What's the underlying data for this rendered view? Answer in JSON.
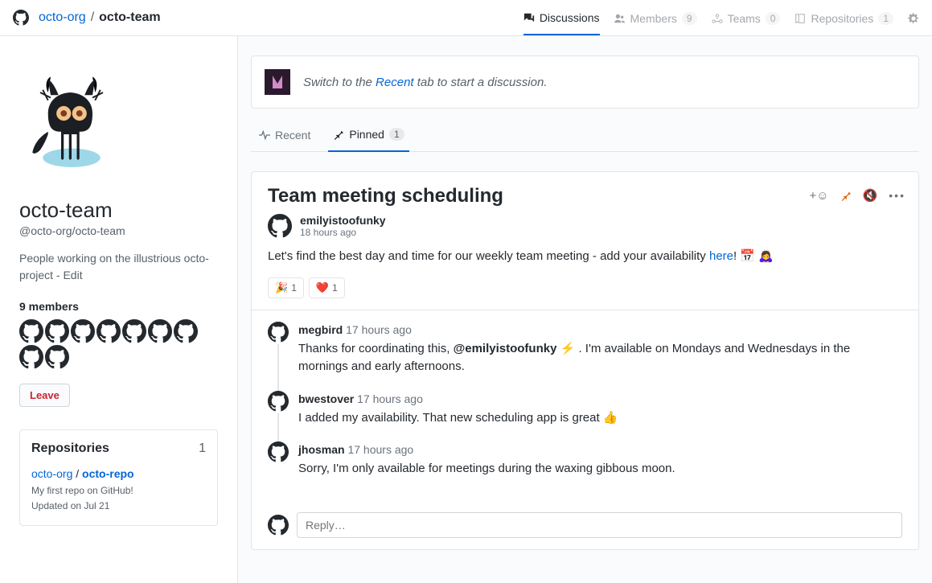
{
  "breadcrumb": {
    "org": "octo-org",
    "team": "octo-team"
  },
  "topnav": {
    "discussions": {
      "label": "Discussions"
    },
    "members": {
      "label": "Members",
      "count": "9"
    },
    "teams": {
      "label": "Teams",
      "count": "0"
    },
    "repositories": {
      "label": "Repositories",
      "count": "1"
    }
  },
  "sidebar": {
    "title": "octo-team",
    "slug": "@octo-org/octo-team",
    "description": "People working on the illustrious octo-project - ",
    "edit": "Edit",
    "members_heading": "9 members",
    "leave_label": "Leave",
    "repos": {
      "heading": "Repositories",
      "count": "1",
      "org": "octo-org",
      "sep": " / ",
      "name": "octo-repo",
      "desc": "My first repo on GitHub!",
      "updated": "Updated on Jul 21"
    }
  },
  "notice": {
    "prefix": "Switch to the ",
    "link": "Recent",
    "suffix": " tab to start a discussion."
  },
  "subtabs": {
    "recent": "Recent",
    "pinned": "Pinned",
    "pinned_count": "1"
  },
  "discussion": {
    "title": "Team meeting scheduling",
    "author": "emilyistoofunky",
    "time": "18 hours ago",
    "body_prefix": "Let's find the best day and time for our weekly team meeting - add your availability ",
    "body_link": "here",
    "body_suffix": "! 📅 🙇‍♀️",
    "reactions": [
      {
        "emoji": "🎉",
        "count": "1"
      },
      {
        "emoji": "❤️",
        "count": "1"
      }
    ],
    "replies": [
      {
        "author": "megbird",
        "time": "17 hours ago",
        "body_prefix": "Thanks for coordinating this, ",
        "mention": "@emilyistoofunky",
        "body_suffix": " ⚡ . I'm available on Mondays and Wednesdays in the mornings and early afternoons."
      },
      {
        "author": "bwestover",
        "time": "17 hours ago",
        "body": "I added my availability. That new scheduling app is great 👍"
      },
      {
        "author": "jhosman",
        "time": "17 hours ago",
        "body": "Sorry, I'm only available for meetings during the waxing gibbous moon."
      }
    ],
    "reply_placeholder": "Reply…"
  }
}
